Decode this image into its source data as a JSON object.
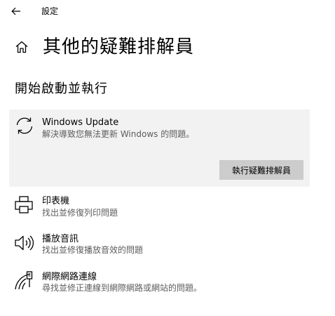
{
  "window": {
    "app_title": "設定",
    "page_title": "其他的疑難排解員",
    "section_title": "開始啟動並執行"
  },
  "troubleshooters": {
    "expanded": {
      "name": "Windows Update",
      "description": "解決導致您無法更新 Windows 的問題。",
      "icon": "sync-icon",
      "run_label": "執行疑難排解員"
    },
    "items": [
      {
        "name": "印表機",
        "description": "找出並修復列印問題",
        "icon": "printer-icon"
      },
      {
        "name": "播放音訊",
        "description": "找出並修復播放音效的問題",
        "icon": "speaker-icon"
      },
      {
        "name": "網際網路連線",
        "description": "尋找並修正連線到網際網路或網站的問題。",
        "icon": "network-icon"
      }
    ]
  },
  "colors": {
    "card_background": "#f2f2f2",
    "button_background": "#cccccc",
    "secondary_text": "#5d5d5d"
  }
}
